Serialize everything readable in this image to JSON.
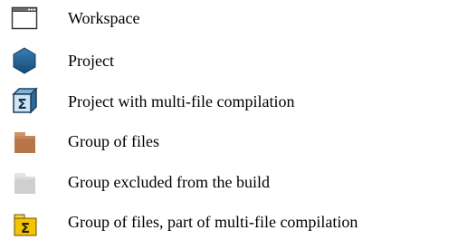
{
  "legend": {
    "items": [
      {
        "icon": "workspace-icon",
        "label": "Workspace"
      },
      {
        "icon": "project-icon",
        "label": "Project"
      },
      {
        "icon": "project-multifile-icon",
        "label": "Project with multi-file compilation"
      },
      {
        "icon": "file-group-icon",
        "label": "Group of files"
      },
      {
        "icon": "excluded-group-icon",
        "label": "Group excluded from the build"
      },
      {
        "icon": "multifile-group-icon",
        "label": "Group of files, part of multi-file compilation"
      }
    ]
  },
  "colors": {
    "project_blue": "#1f5d8c",
    "folder_brown": "#b7754a",
    "excluded_gray": "#cfcfcf",
    "multifile_yellow": "#f2c400"
  }
}
